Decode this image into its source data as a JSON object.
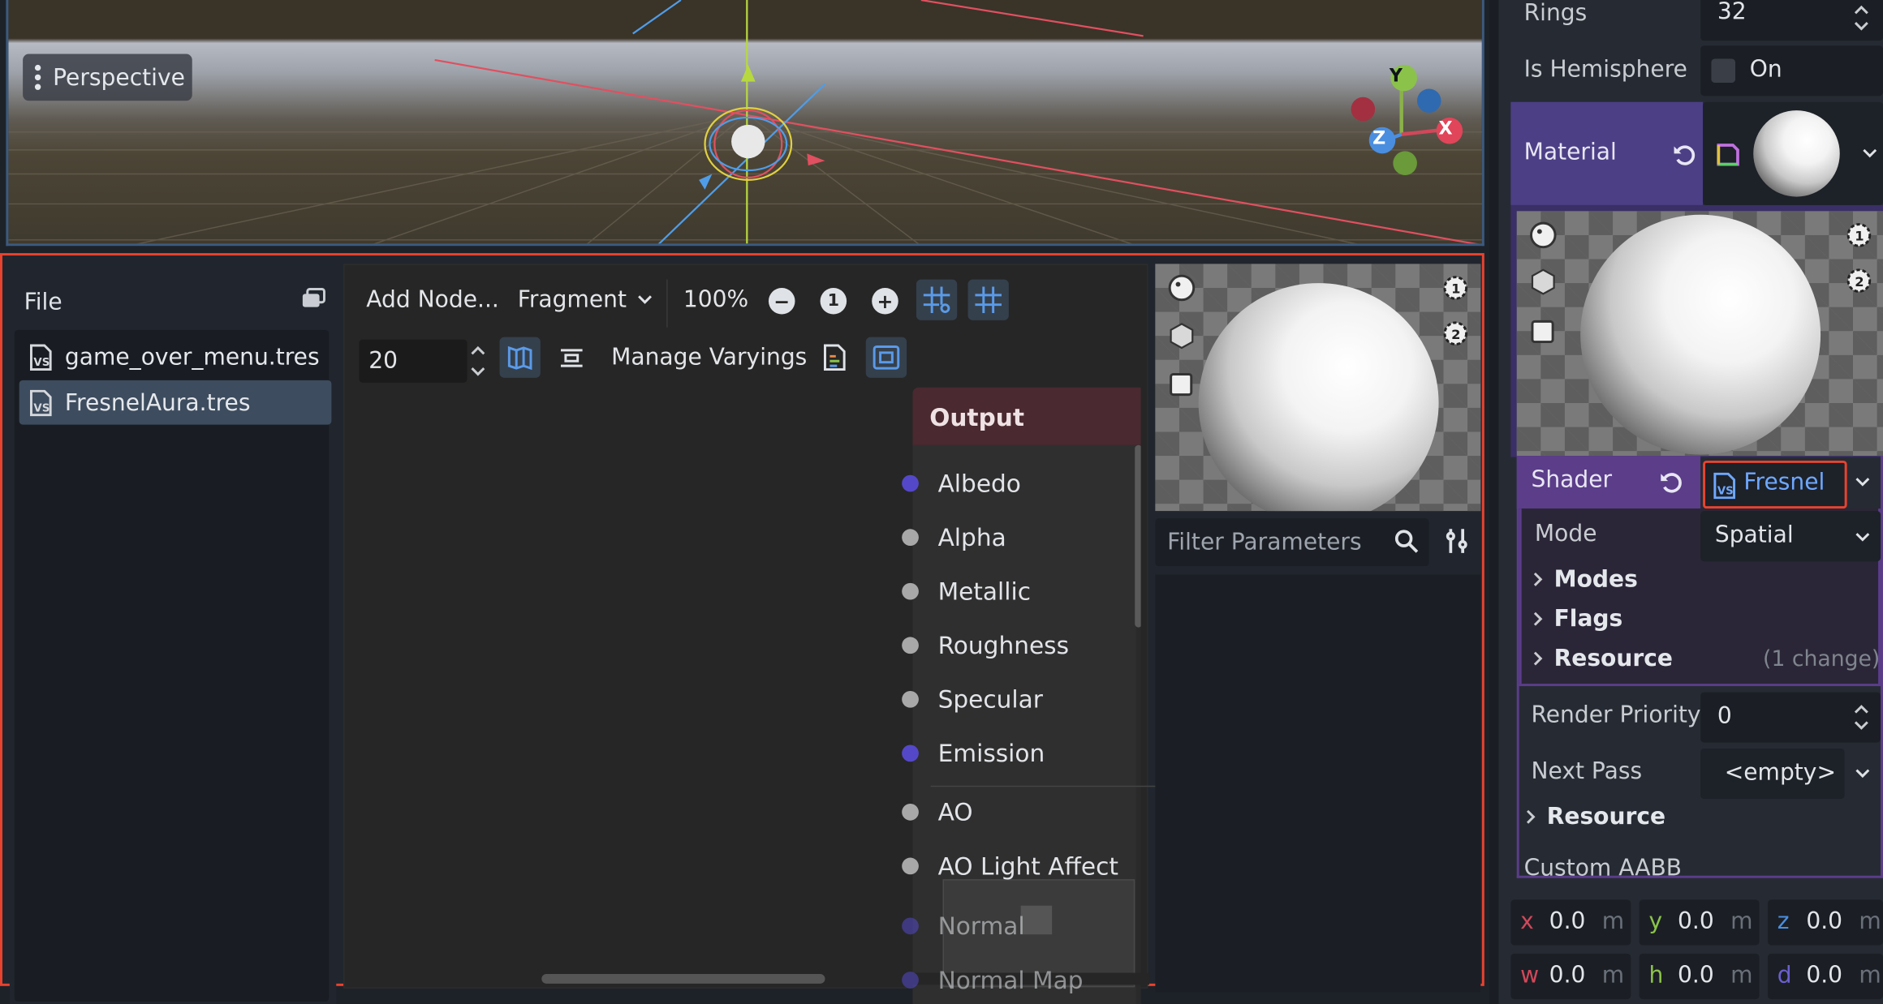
{
  "viewport": {
    "view_mode": "Perspective",
    "gizmo_labels": [
      "Y",
      "X",
      "Z"
    ]
  },
  "file_panel": {
    "header": "File",
    "files": [
      {
        "name": "game_over_menu.tres",
        "selected": false
      },
      {
        "name": "FresnelAura.tres",
        "selected": true
      }
    ]
  },
  "graph_toolbar": {
    "add_node": "Add Node...",
    "shader_type": "Fragment",
    "zoom": "100%",
    "snap_distance": "20",
    "manage_varyings": "Manage Varyings"
  },
  "output_node": {
    "title": "Output",
    "ports": [
      {
        "label": "Albedo",
        "color": "#5448c9"
      },
      {
        "label": "Alpha",
        "color": "#a8a8a8"
      },
      {
        "label": "Metallic",
        "color": "#a8a8a8"
      },
      {
        "label": "Roughness",
        "color": "#a8a8a8"
      },
      {
        "label": "Specular",
        "color": "#a8a8a8"
      },
      {
        "label": "Emission",
        "color": "#5448c9"
      },
      {
        "label": "AO",
        "color": "#a8a8a8"
      },
      {
        "label": "AO Light Affect",
        "color": "#a8a8a8"
      },
      {
        "label": "Normal",
        "color": "#5448c9"
      },
      {
        "label": "Normal Map",
        "color": "#5448c9"
      }
    ]
  },
  "parameters": {
    "filter_placeholder": "Filter Parameters"
  },
  "inspector": {
    "rings_label": "Rings",
    "rings_value": "32",
    "hemisphere_label": "Is Hemisphere",
    "hemisphere_value": "On",
    "material_label": "Material",
    "shader_label": "Shader",
    "shader_value": "Fresnel",
    "mode_label": "Mode",
    "mode_value": "Spatial",
    "modes_section": "Modes",
    "flags_section": "Flags",
    "resource_section": "Resource",
    "resource_change": "(1 change)",
    "render_priority_label": "Render Priority",
    "render_priority_value": "0",
    "next_pass_label": "Next Pass",
    "next_pass_value": "<empty>",
    "resource_section2": "Resource",
    "custom_aabb_label": "Custom AABB",
    "aabb": {
      "x": "0.0",
      "y": "0.0",
      "z": "0.0",
      "w": "0.0",
      "h": "0.0",
      "d": "0.0",
      "unit": "m"
    }
  },
  "colors": {
    "accent_red": "#e8432f",
    "material_purple": "#4c3f86",
    "shader_purple": "#5b3d8a",
    "link_blue": "#6ea8ff"
  }
}
